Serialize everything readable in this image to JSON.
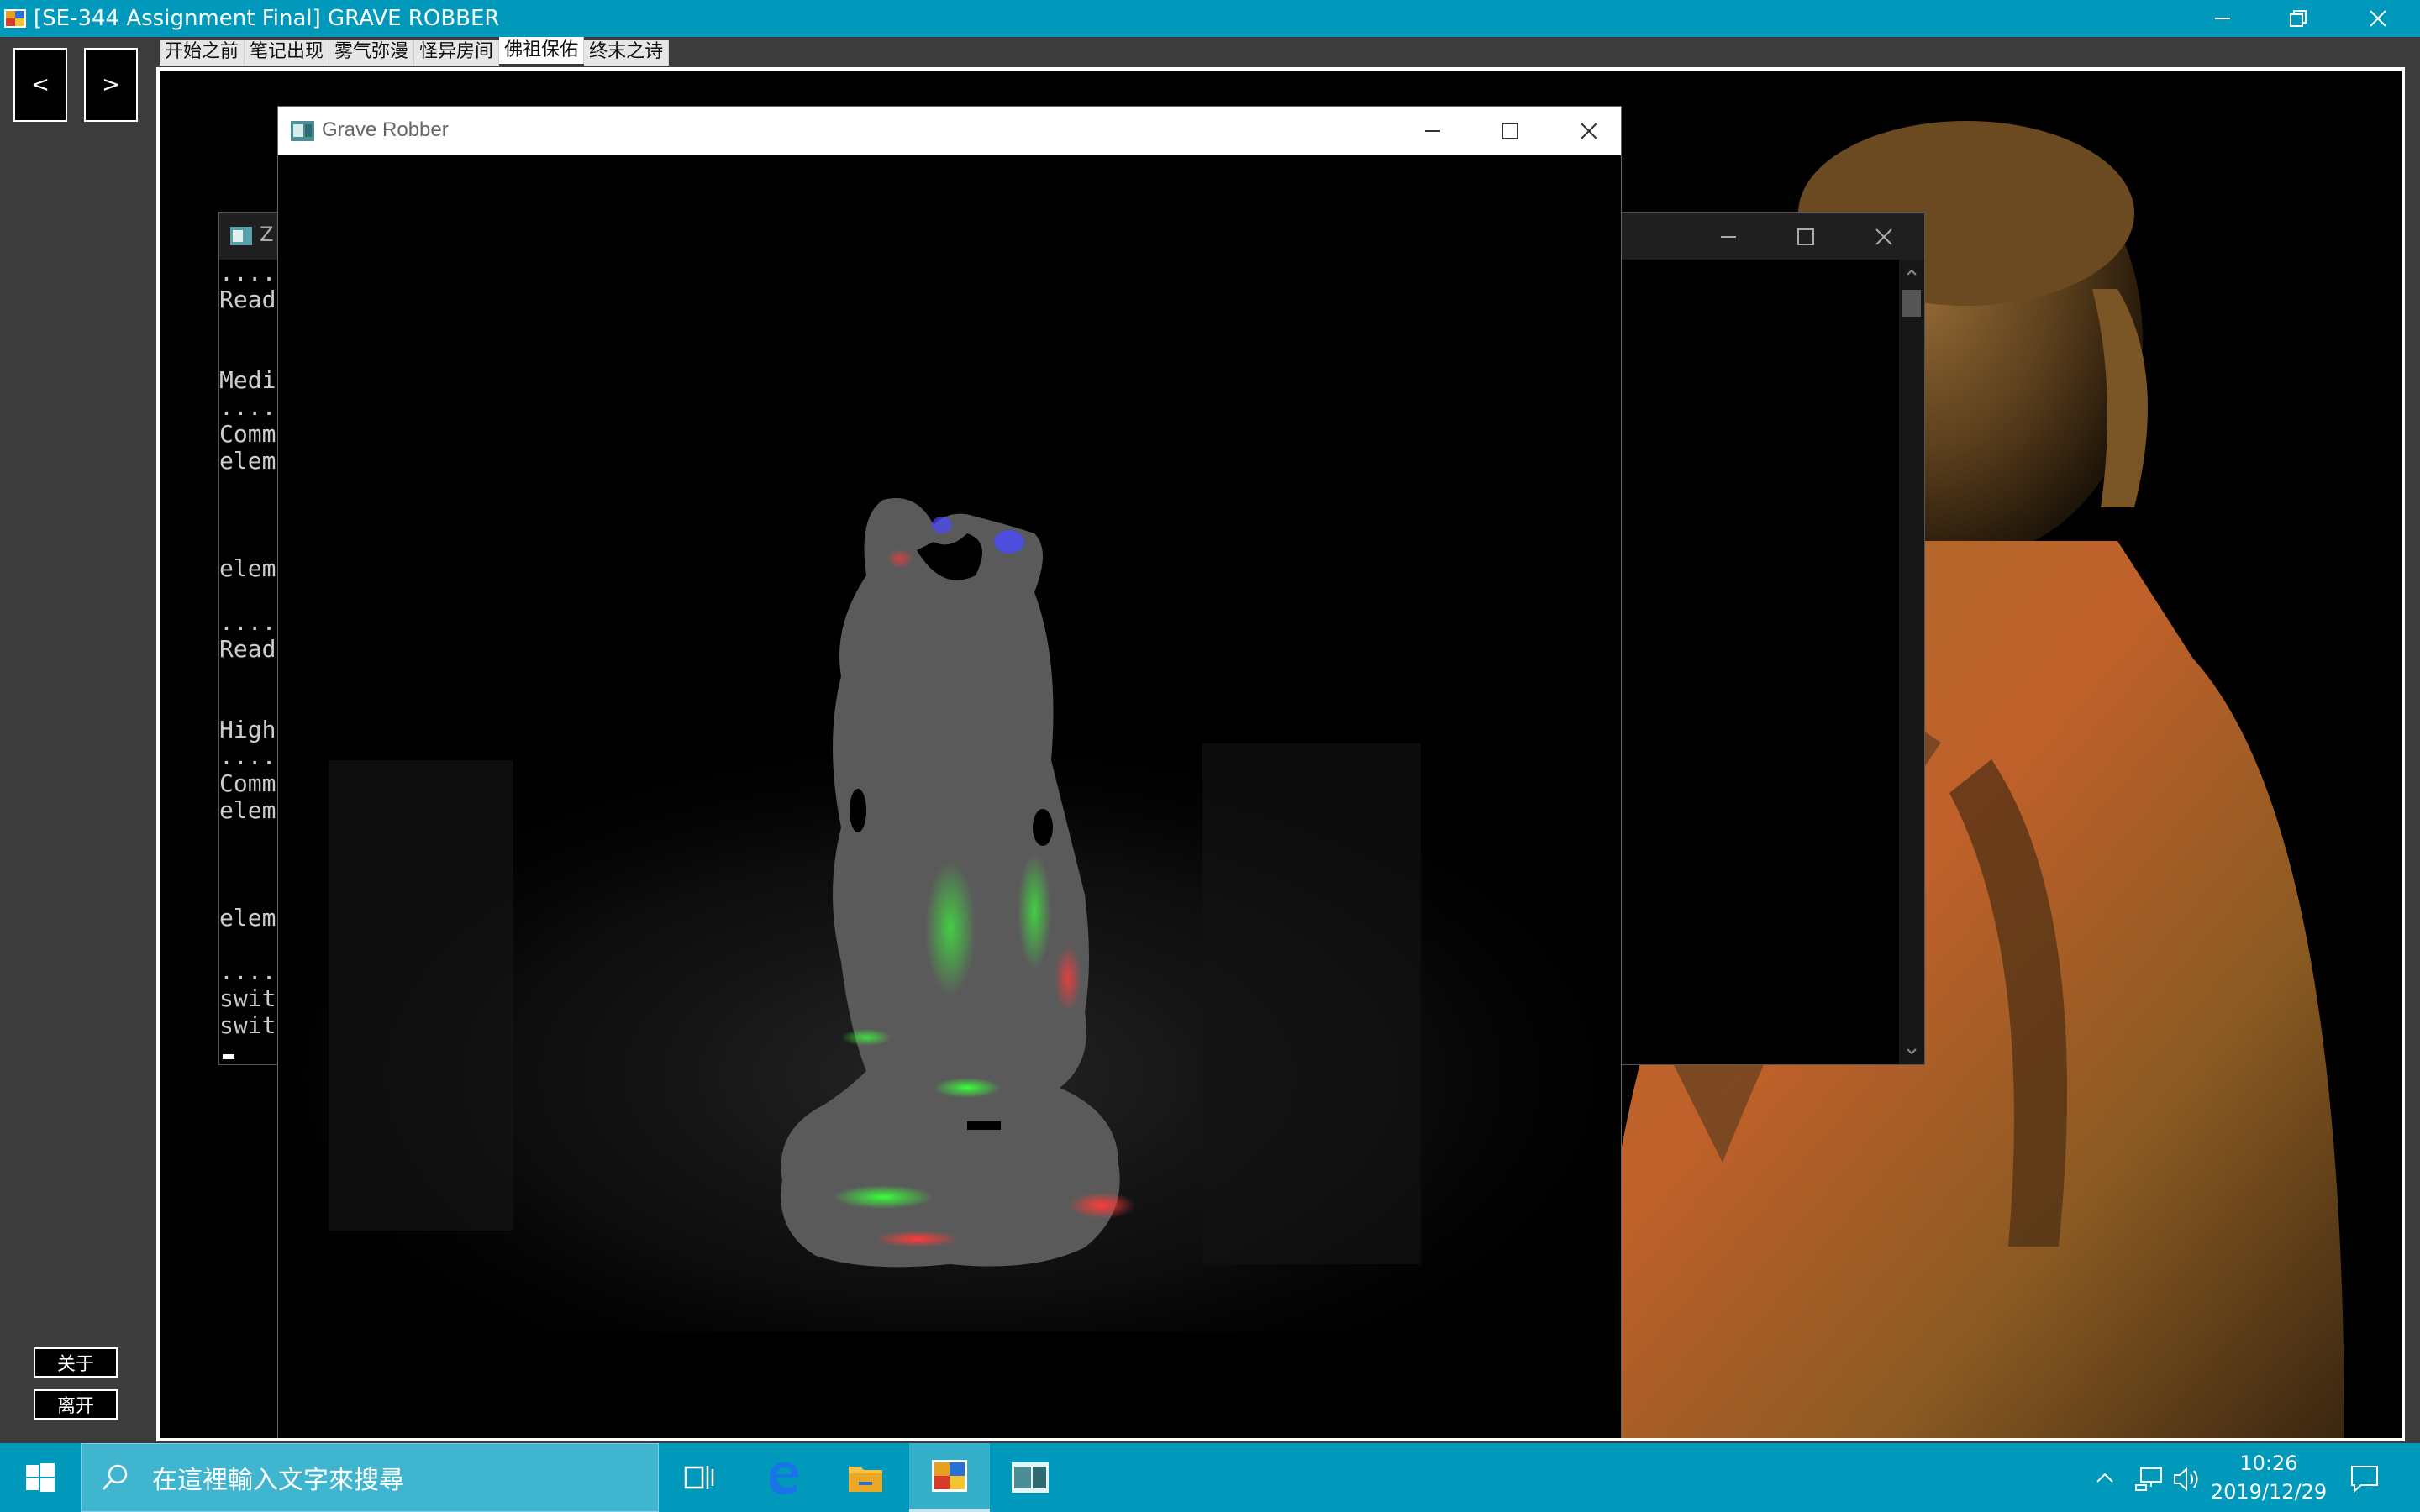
{
  "window": {
    "title": "[SE-344 Assignment Final] GRAVE ROBBER"
  },
  "nav": {
    "prev_label": "<",
    "next_label": ">"
  },
  "tabs": [
    {
      "label": "开始之前"
    },
    {
      "label": "笔记出现"
    },
    {
      "label": "雾气弥漫"
    },
    {
      "label": "怪异房间"
    },
    {
      "label": "佛祖保佑",
      "active": true
    },
    {
      "label": "终末之诗"
    }
  ],
  "sidebar": {
    "about_label": "关于",
    "exit_label": "离开"
  },
  "console": {
    "title_fragment": "Z",
    "lines": [
      "....",
      "Read",
      "",
      "",
      "Medi",
      "....",
      "Comm",
      "elem",
      "",
      "",
      "",
      "elem",
      "",
      "....",
      "Read",
      "",
      "",
      "High",
      "....",
      "Comm",
      "elem",
      "",
      "",
      "",
      "elem",
      "",
      "....",
      "swit",
      "swit"
    ]
  },
  "render_window": {
    "title": "Grave Robber"
  },
  "taskbar": {
    "search_placeholder": "在這裡輸入文字來搜尋",
    "time": "10:26",
    "date": "2019/12/29"
  },
  "colors": {
    "titlebar": "#0099bc",
    "taskbar": "#0099bc",
    "app_background": "#3c3c3c"
  },
  "icons": [
    "app-icon",
    "minimize-icon",
    "restore-icon",
    "close-icon",
    "windows-start-icon",
    "search-icon",
    "task-view-icon",
    "edge-icon",
    "file-explorer-icon",
    "grave-robber-app-icon",
    "opengl-window-icon",
    "chevron-up-icon",
    "network-icon",
    "volume-icon",
    "action-center-icon"
  ]
}
